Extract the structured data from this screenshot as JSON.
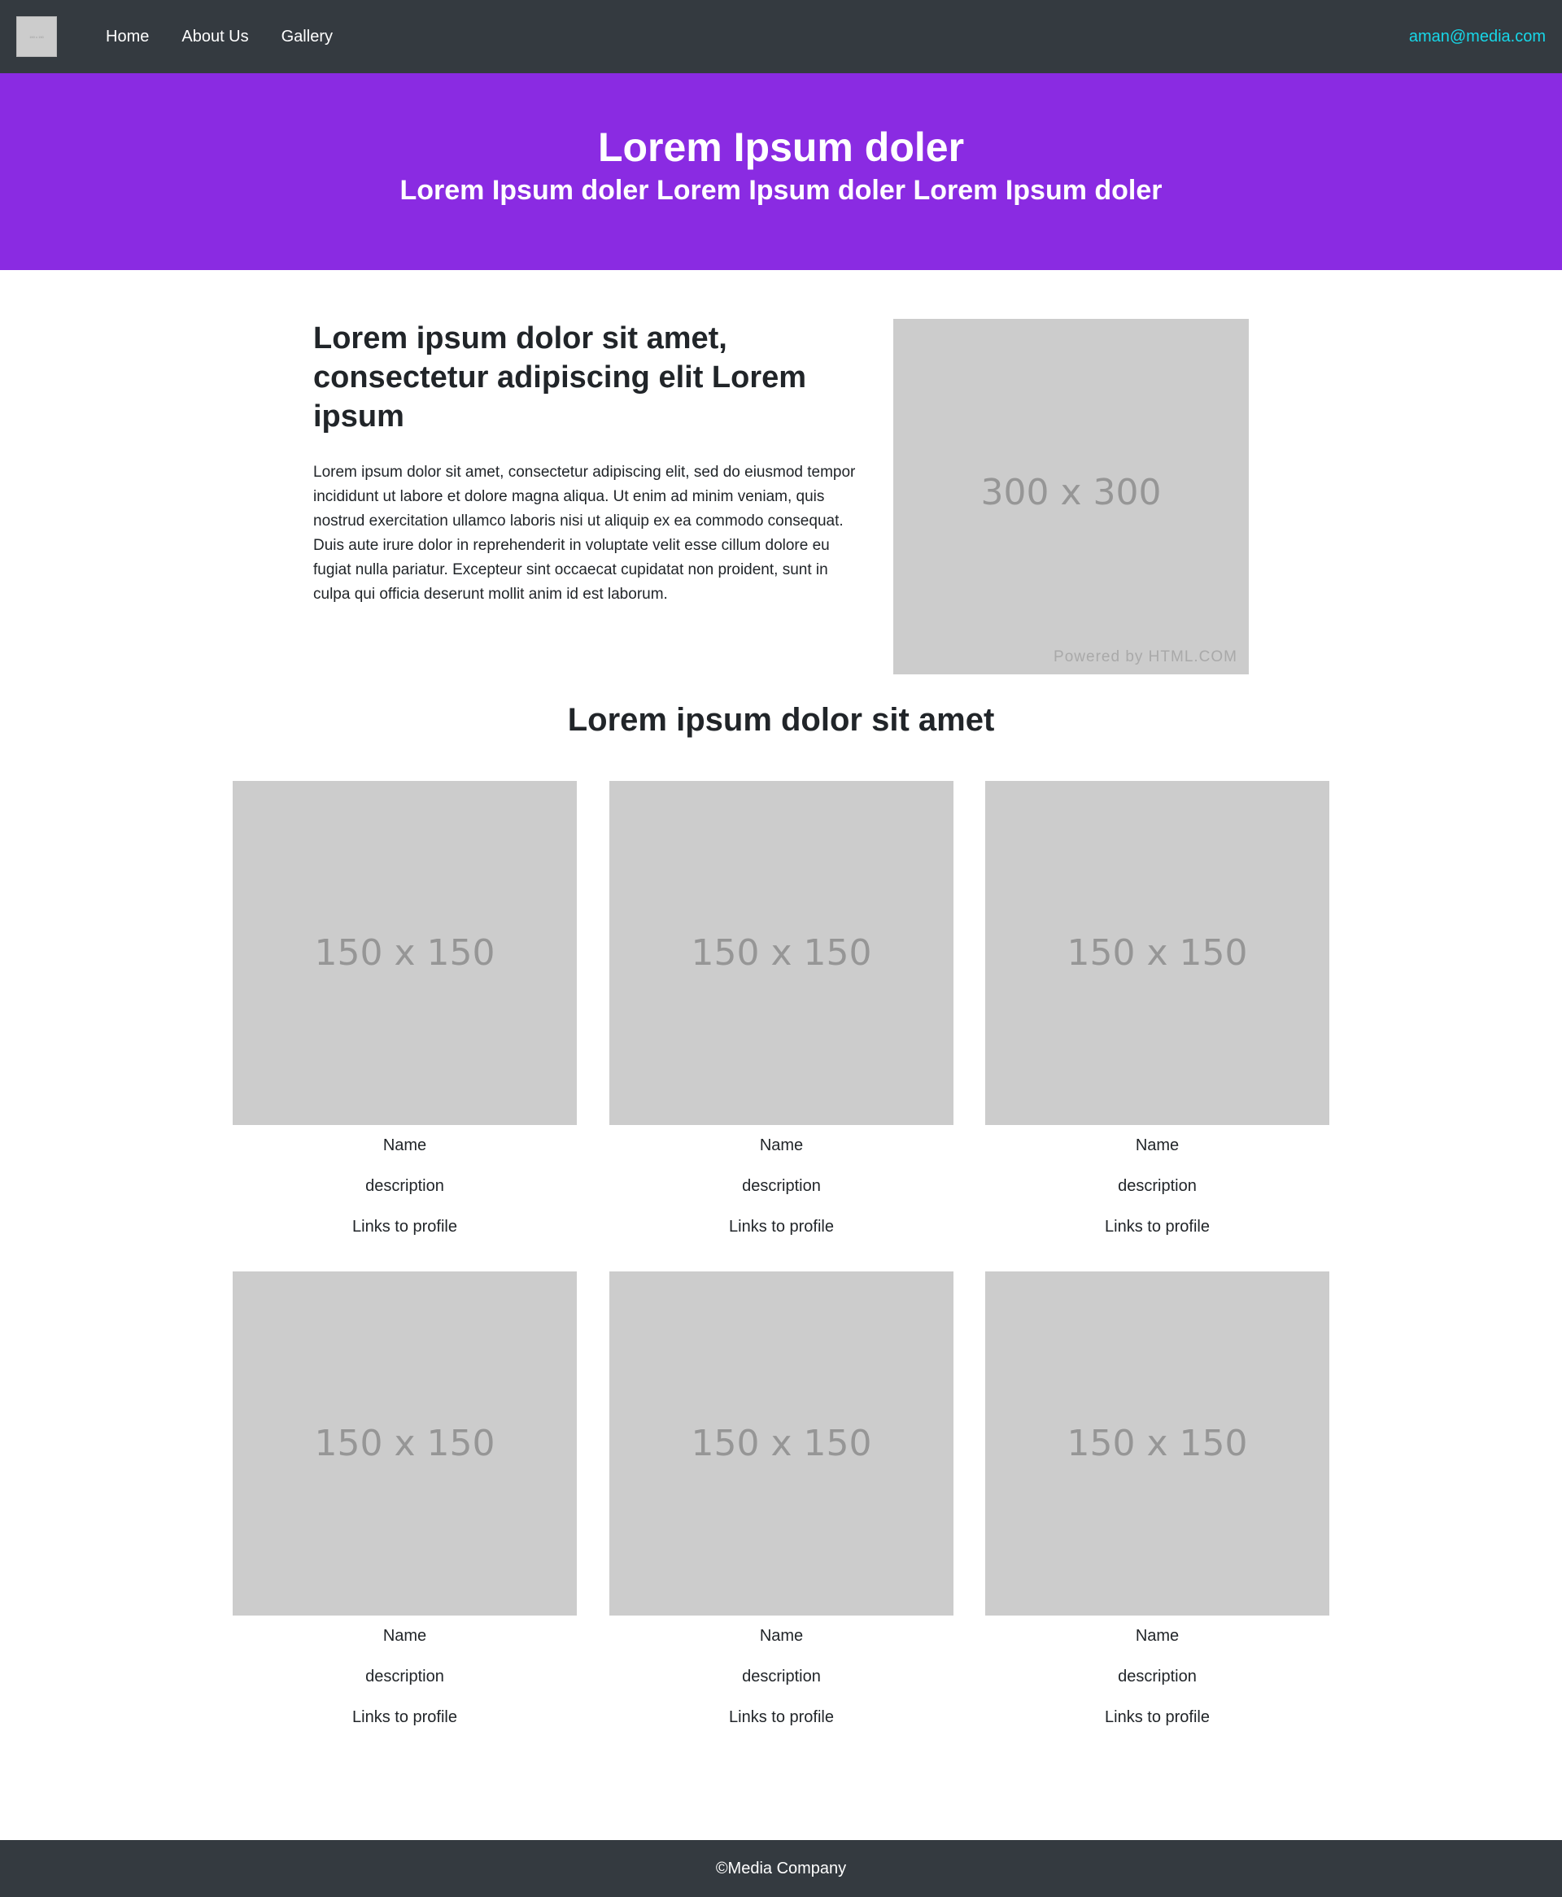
{
  "nav": {
    "logo_text": "150 x 150",
    "links": [
      "Home",
      "About Us",
      "Gallery"
    ],
    "email": "aman@media.com"
  },
  "hero": {
    "title": "Lorem Ipsum doler",
    "subtitle": "Lorem Ipsum doler Lorem Ipsum doler Lorem Ipsum doler"
  },
  "intro": {
    "heading": "Lorem ipsum dolor sit amet, consectetur adipiscing elit Lorem ipsum",
    "body": "Lorem ipsum dolor sit amet, consectetur adipiscing elit, sed do eiusmod tempor incididunt ut labore et dolore magna aliqua. Ut enim ad minim veniam, quis nostrud exercitation ullamco laboris nisi ut aliquip ex ea commodo consequat. Duis aute irure dolor in reprehenderit in voluptate velit esse cillum dolore eu fugiat nulla pariatur. Excepteur sint occaecat cupidatat non proident, sunt in culpa qui officia deserunt mollit anim id est laborum.",
    "image_label": "300 x 300",
    "image_credit": "Powered by HTML.COM"
  },
  "team": {
    "heading": "Lorem ipsum dolor sit amet",
    "cards": [
      {
        "image_label": "150 x 150",
        "name": "Name",
        "description": "description",
        "link": "Links to profile"
      },
      {
        "image_label": "150 x 150",
        "name": "Name",
        "description": "description",
        "link": "Links to profile"
      },
      {
        "image_label": "150 x 150",
        "name": "Name",
        "description": "description",
        "link": "Links to profile"
      },
      {
        "image_label": "150 x 150",
        "name": "Name",
        "description": "description",
        "link": "Links to profile"
      },
      {
        "image_label": "150 x 150",
        "name": "Name",
        "description": "description",
        "link": "Links to profile"
      },
      {
        "image_label": "150 x 150",
        "name": "Name",
        "description": "description",
        "link": "Links to profile"
      }
    ]
  },
  "footer": {
    "text": "©Media Company"
  },
  "colors": {
    "navbar": "#343a40",
    "hero": "#8a2be2",
    "email_link": "#17d7e8",
    "placeholder": "#cccccc"
  }
}
